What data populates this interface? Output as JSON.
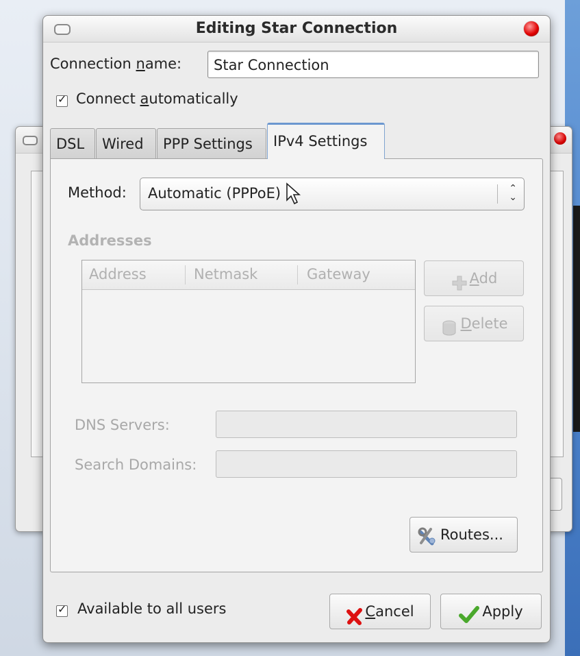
{
  "dialog": {
    "title": "Editing Star Connection",
    "connection_name_label_pre": "Connection ",
    "connection_name_label_u": "n",
    "connection_name_label_post": "ame:",
    "connection_name_value": "Star Connection",
    "connect_auto_pre": "Connect ",
    "connect_auto_u": "a",
    "connect_auto_post": "utomatically",
    "connect_auto_checked": true
  },
  "tabs": [
    {
      "label": "DSL"
    },
    {
      "label": "Wired"
    },
    {
      "label": "PPP Settings"
    },
    {
      "label": "IPv4 Settings",
      "active": true
    }
  ],
  "ipv4": {
    "method_label": "Method:",
    "method_value": "Automatic (PPPoE)",
    "addresses_heading": "Addresses",
    "columns": [
      "Address",
      "Netmask",
      "Gateway"
    ],
    "add_label_u": "A",
    "add_label_post": "dd",
    "delete_label_u": "D",
    "delete_label_post": "elete",
    "dns_label": "DNS Servers:",
    "search_label": "Search Domains:",
    "routes_label": "Routes..."
  },
  "footer": {
    "available_label": "Available to all users",
    "available_checked": true,
    "cancel_u": "C",
    "cancel_post": "ancel",
    "apply_label": "Apply"
  }
}
